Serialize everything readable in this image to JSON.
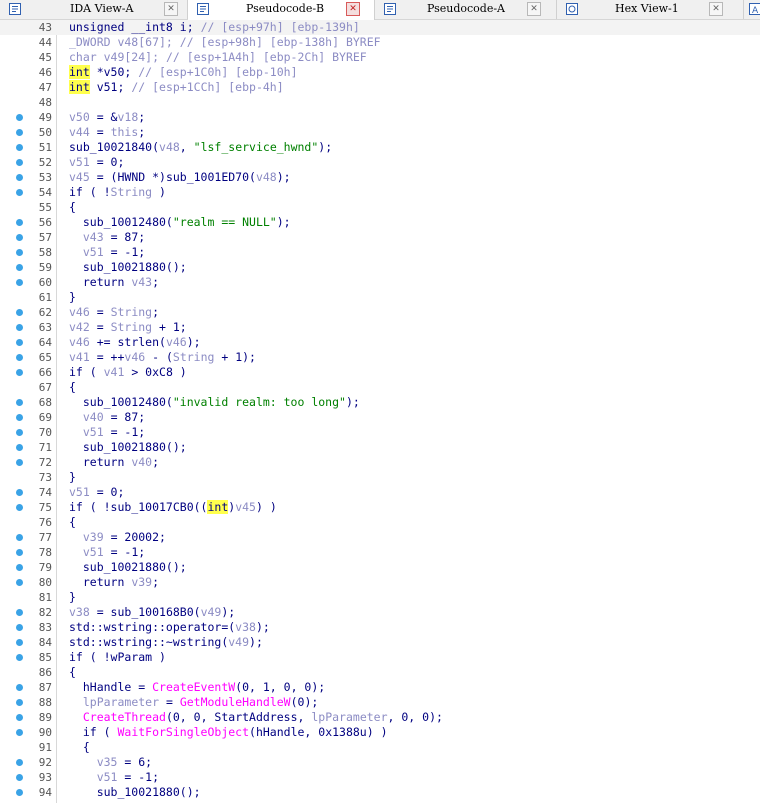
{
  "tabs": [
    {
      "label": "IDA View-A",
      "icon": "ida-view-icon",
      "active": false
    },
    {
      "label": "Pseudocode-B",
      "icon": "pseudocode-icon",
      "active": true
    },
    {
      "label": "Pseudocode-A",
      "icon": "pseudocode-icon",
      "active": false
    },
    {
      "label": "Hex View-1",
      "icon": "hex-view-icon",
      "active": false
    }
  ],
  "colors": {
    "normal": "#000080",
    "variable": "#8c8cc4",
    "string": "#008000",
    "comment": "#8c8cc4",
    "import": "#ff00ff",
    "highlight": "#ffff4d",
    "breakpoint_dot": "#3aa3e6"
  },
  "lines": [
    {
      "num": "43",
      "dot": false,
      "tokens": [
        [
          "n",
          "unsigned __int8 i; "
        ],
        [
          "c",
          "// [esp+97h] [ebp-139h]"
        ]
      ]
    },
    {
      "num": "44",
      "dot": false,
      "tokens": [
        [
          "v",
          "_DWORD v48[67]; "
        ],
        [
          "c",
          "// [esp+98h] [ebp-138h] BYREF"
        ]
      ]
    },
    {
      "num": "45",
      "dot": false,
      "tokens": [
        [
          "v",
          "char v49[24]; "
        ],
        [
          "c",
          "// [esp+1A4h] [ebp-2Ch] BYREF"
        ]
      ]
    },
    {
      "num": "46",
      "dot": false,
      "tokens": [
        [
          "h",
          "int"
        ],
        [
          "n",
          " *v50; "
        ],
        [
          "c",
          "// [esp+1C0h] [ebp-10h]"
        ]
      ]
    },
    {
      "num": "47",
      "dot": false,
      "tokens": [
        [
          "h",
          "int"
        ],
        [
          "n",
          " v51; "
        ],
        [
          "c",
          "// [esp+1CCh] [ebp-4h]"
        ]
      ]
    },
    {
      "num": "48",
      "dot": false,
      "tokens": []
    },
    {
      "num": "49",
      "dot": true,
      "tokens": [
        [
          "v",
          "v50"
        ],
        [
          "n",
          " = &"
        ],
        [
          "v",
          "v18"
        ],
        [
          "n",
          ";"
        ]
      ]
    },
    {
      "num": "50",
      "dot": true,
      "tokens": [
        [
          "v",
          "v44"
        ],
        [
          "n",
          " = "
        ],
        [
          "v",
          "this"
        ],
        [
          "n",
          ";"
        ]
      ]
    },
    {
      "num": "51",
      "dot": true,
      "tokens": [
        [
          "n",
          "sub_10021840("
        ],
        [
          "v",
          "v48"
        ],
        [
          "n",
          ", "
        ],
        [
          "s",
          "\"lsf_service_hwnd\""
        ],
        [
          "n",
          ");"
        ]
      ]
    },
    {
      "num": "52",
      "dot": true,
      "tokens": [
        [
          "v",
          "v51"
        ],
        [
          "n",
          " = 0;"
        ]
      ]
    },
    {
      "num": "53",
      "dot": true,
      "tokens": [
        [
          "v",
          "v45"
        ],
        [
          "n",
          " = (HWND *)sub_1001ED70("
        ],
        [
          "v",
          "v48"
        ],
        [
          "n",
          ");"
        ]
      ]
    },
    {
      "num": "54",
      "dot": true,
      "tokens": [
        [
          "n",
          "if ( !"
        ],
        [
          "v",
          "String"
        ],
        [
          "n",
          " )"
        ]
      ]
    },
    {
      "num": "55",
      "dot": false,
      "tokens": [
        [
          "n",
          "{"
        ]
      ]
    },
    {
      "num": "56",
      "dot": true,
      "tokens": [
        [
          "n",
          "  sub_10012480("
        ],
        [
          "s",
          "\"realm == NULL\""
        ],
        [
          "n",
          ");"
        ]
      ]
    },
    {
      "num": "57",
      "dot": true,
      "tokens": [
        [
          "n",
          "  "
        ],
        [
          "v",
          "v43"
        ],
        [
          "n",
          " = 87;"
        ]
      ]
    },
    {
      "num": "58",
      "dot": true,
      "tokens": [
        [
          "n",
          "  "
        ],
        [
          "v",
          "v51"
        ],
        [
          "n",
          " = -1;"
        ]
      ]
    },
    {
      "num": "59",
      "dot": true,
      "tokens": [
        [
          "n",
          "  sub_10021880();"
        ]
      ]
    },
    {
      "num": "60",
      "dot": true,
      "tokens": [
        [
          "n",
          "  return "
        ],
        [
          "v",
          "v43"
        ],
        [
          "n",
          ";"
        ]
      ]
    },
    {
      "num": "61",
      "dot": false,
      "tokens": [
        [
          "n",
          "}"
        ]
      ]
    },
    {
      "num": "62",
      "dot": true,
      "tokens": [
        [
          "v",
          "v46"
        ],
        [
          "n",
          " = "
        ],
        [
          "v",
          "String"
        ],
        [
          "n",
          ";"
        ]
      ]
    },
    {
      "num": "63",
      "dot": true,
      "tokens": [
        [
          "v",
          "v42"
        ],
        [
          "n",
          " = "
        ],
        [
          "v",
          "String"
        ],
        [
          "n",
          " + 1;"
        ]
      ]
    },
    {
      "num": "64",
      "dot": true,
      "tokens": [
        [
          "v",
          "v46"
        ],
        [
          "n",
          " += strlen("
        ],
        [
          "v",
          "v46"
        ],
        [
          "n",
          ");"
        ]
      ]
    },
    {
      "num": "65",
      "dot": true,
      "tokens": [
        [
          "v",
          "v41"
        ],
        [
          "n",
          " = ++"
        ],
        [
          "v",
          "v46"
        ],
        [
          "n",
          " - ("
        ],
        [
          "v",
          "String"
        ],
        [
          "n",
          " + 1);"
        ]
      ]
    },
    {
      "num": "66",
      "dot": true,
      "tokens": [
        [
          "n",
          "if ( "
        ],
        [
          "v",
          "v41"
        ],
        [
          "n",
          " > 0xC8 )"
        ]
      ]
    },
    {
      "num": "67",
      "dot": false,
      "tokens": [
        [
          "n",
          "{"
        ]
      ]
    },
    {
      "num": "68",
      "dot": true,
      "tokens": [
        [
          "n",
          "  sub_10012480("
        ],
        [
          "s",
          "\"invalid realm: too long\""
        ],
        [
          "n",
          ");"
        ]
      ]
    },
    {
      "num": "69",
      "dot": true,
      "tokens": [
        [
          "n",
          "  "
        ],
        [
          "v",
          "v40"
        ],
        [
          "n",
          " = 87;"
        ]
      ]
    },
    {
      "num": "70",
      "dot": true,
      "tokens": [
        [
          "n",
          "  "
        ],
        [
          "v",
          "v51"
        ],
        [
          "n",
          " = -1;"
        ]
      ]
    },
    {
      "num": "71",
      "dot": true,
      "tokens": [
        [
          "n",
          "  sub_10021880();"
        ]
      ]
    },
    {
      "num": "72",
      "dot": true,
      "tokens": [
        [
          "n",
          "  return "
        ],
        [
          "v",
          "v40"
        ],
        [
          "n",
          ";"
        ]
      ]
    },
    {
      "num": "73",
      "dot": false,
      "tokens": [
        [
          "n",
          "}"
        ]
      ]
    },
    {
      "num": "74",
      "dot": true,
      "tokens": [
        [
          "v",
          "v51"
        ],
        [
          "n",
          " = 0;"
        ]
      ]
    },
    {
      "num": "75",
      "dot": true,
      "tokens": [
        [
          "n",
          "if ( !sub_10017CB0(("
        ],
        [
          "h",
          "int"
        ],
        [
          "n",
          ")"
        ],
        [
          "v",
          "v45"
        ],
        [
          "n",
          ") )"
        ]
      ]
    },
    {
      "num": "76",
      "dot": false,
      "tokens": [
        [
          "n",
          "{"
        ]
      ]
    },
    {
      "num": "77",
      "dot": true,
      "tokens": [
        [
          "n",
          "  "
        ],
        [
          "v",
          "v39"
        ],
        [
          "n",
          " = 20002;"
        ]
      ]
    },
    {
      "num": "78",
      "dot": true,
      "tokens": [
        [
          "n",
          "  "
        ],
        [
          "v",
          "v51"
        ],
        [
          "n",
          " = -1;"
        ]
      ]
    },
    {
      "num": "79",
      "dot": true,
      "tokens": [
        [
          "n",
          "  sub_10021880();"
        ]
      ]
    },
    {
      "num": "80",
      "dot": true,
      "tokens": [
        [
          "n",
          "  return "
        ],
        [
          "v",
          "v39"
        ],
        [
          "n",
          ";"
        ]
      ]
    },
    {
      "num": "81",
      "dot": false,
      "tokens": [
        [
          "n",
          "}"
        ]
      ]
    },
    {
      "num": "82",
      "dot": true,
      "tokens": [
        [
          "v",
          "v38"
        ],
        [
          "n",
          " = sub_100168B0("
        ],
        [
          "v",
          "v49"
        ],
        [
          "n",
          ");"
        ]
      ]
    },
    {
      "num": "83",
      "dot": true,
      "tokens": [
        [
          "n",
          "std::wstring::operator=("
        ],
        [
          "v",
          "v38"
        ],
        [
          "n",
          ");"
        ]
      ]
    },
    {
      "num": "84",
      "dot": true,
      "tokens": [
        [
          "n",
          "std::wstring::~wstring("
        ],
        [
          "v",
          "v49"
        ],
        [
          "n",
          ");"
        ]
      ]
    },
    {
      "num": "85",
      "dot": true,
      "tokens": [
        [
          "n",
          "if ( !wParam )"
        ]
      ]
    },
    {
      "num": "86",
      "dot": false,
      "tokens": [
        [
          "n",
          "{"
        ]
      ]
    },
    {
      "num": "87",
      "dot": true,
      "tokens": [
        [
          "n",
          "  hHandle = "
        ],
        [
          "i",
          "CreateEventW"
        ],
        [
          "n",
          "(0, 1, 0, 0);"
        ]
      ]
    },
    {
      "num": "88",
      "dot": true,
      "tokens": [
        [
          "n",
          "  "
        ],
        [
          "v",
          "lpParameter"
        ],
        [
          "n",
          " = "
        ],
        [
          "i",
          "GetModuleHandleW"
        ],
        [
          "n",
          "(0);"
        ]
      ]
    },
    {
      "num": "89",
      "dot": true,
      "tokens": [
        [
          "n",
          "  "
        ],
        [
          "i",
          "CreateThread"
        ],
        [
          "n",
          "(0, 0, StartAddress, "
        ],
        [
          "v",
          "lpParameter"
        ],
        [
          "n",
          ", 0, 0);"
        ]
      ]
    },
    {
      "num": "90",
      "dot": true,
      "tokens": [
        [
          "n",
          "  if ( "
        ],
        [
          "i",
          "WaitForSingleObject"
        ],
        [
          "n",
          "(hHandle, 0x1388u) )"
        ]
      ]
    },
    {
      "num": "91",
      "dot": false,
      "tokens": [
        [
          "n",
          "  {"
        ]
      ]
    },
    {
      "num": "92",
      "dot": true,
      "tokens": [
        [
          "n",
          "    "
        ],
        [
          "v",
          "v35"
        ],
        [
          "n",
          " = 6;"
        ]
      ]
    },
    {
      "num": "93",
      "dot": true,
      "tokens": [
        [
          "n",
          "    "
        ],
        [
          "v",
          "v51"
        ],
        [
          "n",
          " = -1;"
        ]
      ]
    },
    {
      "num": "94",
      "dot": true,
      "tokens": [
        [
          "n",
          "    sub_10021880();"
        ]
      ]
    }
  ]
}
